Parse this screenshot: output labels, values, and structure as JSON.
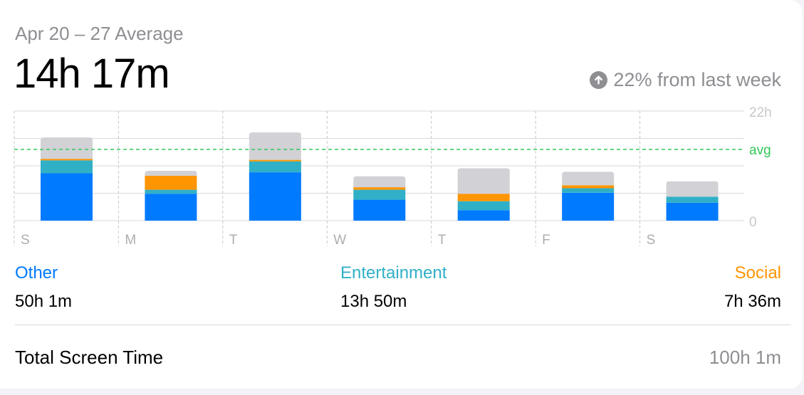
{
  "header": {
    "range_label": "Apr 20 – 27 Average",
    "average": "14h 17m",
    "change_text": "22% from last week",
    "change_icon": "arrow-up-circle-icon"
  },
  "chart_data": {
    "type": "bar",
    "stacked": true,
    "categories": [
      "S",
      "M",
      "T",
      "W",
      "T",
      "F",
      "S"
    ],
    "series": [
      {
        "name": "Other",
        "color": "#007aff",
        "values": [
          9.5,
          5.4,
          9.7,
          4.2,
          2.1,
          5.6,
          3.6
        ]
      },
      {
        "name": "Entertainment",
        "color": "#30b0c7",
        "values": [
          2.6,
          0.8,
          2.2,
          2.0,
          1.8,
          0.9,
          1.2
        ]
      },
      {
        "name": "Social",
        "color": "#ff9500",
        "values": [
          0.3,
          2.8,
          0.3,
          0.5,
          1.5,
          0.6,
          0.0
        ]
      },
      {
        "color": "#d1d1d6",
        "values": [
          4.3,
          1.0,
          5.5,
          2.2,
          5.1,
          2.7,
          3.1
        ]
      }
    ],
    "ylim": [
      0,
      22
    ],
    "y_ticks": [
      {
        "value": 22,
        "label": "22h"
      },
      {
        "value": 0,
        "label": "0"
      }
    ],
    "avg_value": 14.3,
    "avg_label": "avg",
    "avg_color": "#34c759",
    "grid": true
  },
  "legend": [
    {
      "label": "Other",
      "value": "50h 1m",
      "color": "#007aff"
    },
    {
      "label": "Entertainment",
      "value": "13h 50m",
      "color": "#30b0c7"
    },
    {
      "label": "Social",
      "value": "7h 36m",
      "color": "#ff9500"
    }
  ],
  "total": {
    "label": "Total Screen Time",
    "value": "100h 1m"
  }
}
